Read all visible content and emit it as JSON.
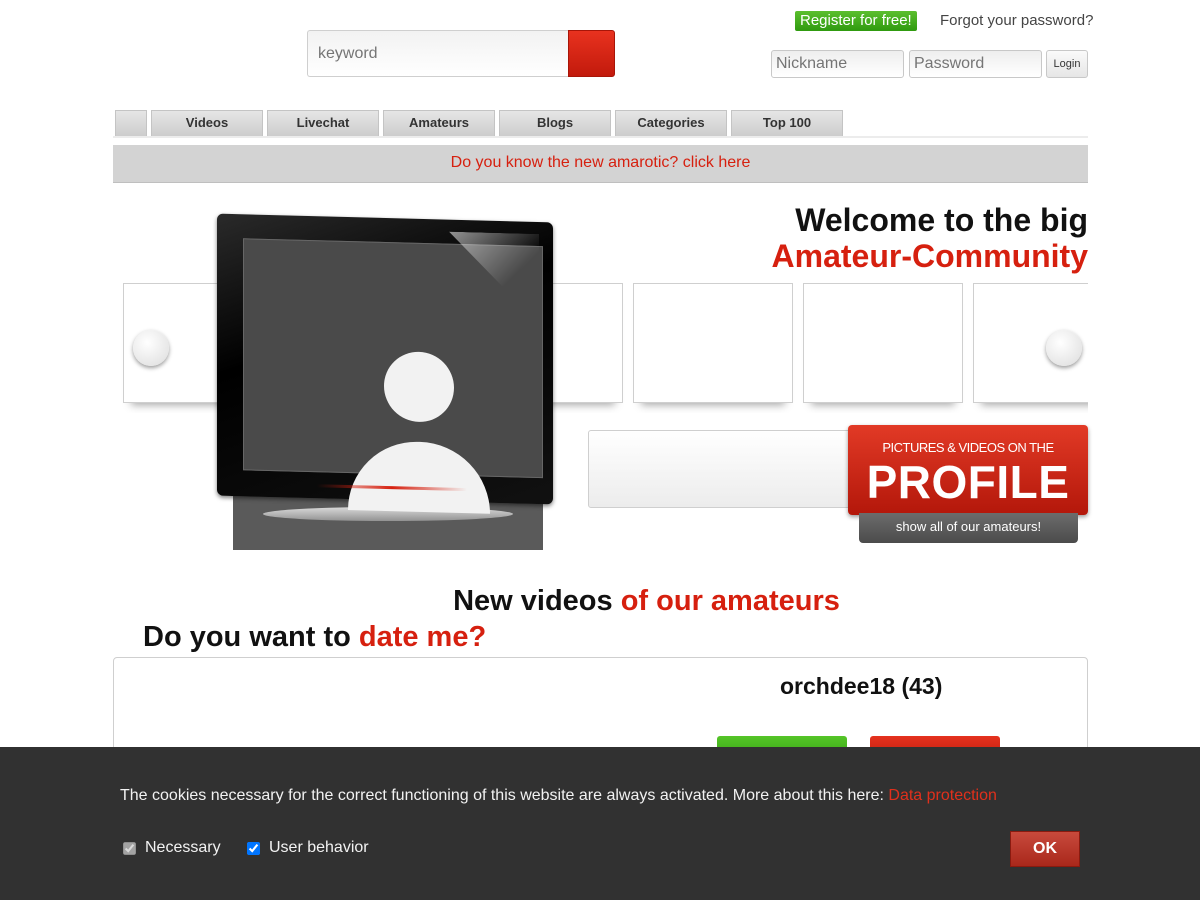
{
  "header": {
    "search_placeholder": "keyword",
    "register_label": "Register for free!",
    "forgot_label": "Forgot your password?",
    "nickname_placeholder": "Nickname",
    "password_placeholder": "Password",
    "login_label": "Login"
  },
  "nav": {
    "tabs": [
      {
        "label": ""
      },
      {
        "label": "Videos"
      },
      {
        "label": "Livechat"
      },
      {
        "label": "Amateurs"
      },
      {
        "label": "Blogs"
      },
      {
        "label": "Categories"
      },
      {
        "label": "Top 100"
      }
    ]
  },
  "notice": "Do you know the new amarotic? click here",
  "welcome": {
    "line1": "Welcome to the big",
    "line2": "Amateur-Community"
  },
  "profile_promo": {
    "small": "PICTURES & VIDEOS ON THE",
    "big": "PROFILE",
    "show_all": "show all of our amateurs!"
  },
  "videos_heading": {
    "part1": "New videos ",
    "part2": "of our amateurs"
  },
  "date_heading": {
    "part1": "Do you want to ",
    "part2": "date me?"
  },
  "date_card": {
    "name": "orchdee18 (43)"
  },
  "cookie": {
    "text": "The cookies necessary for the correct functioning of this website are always activated. More about this here: ",
    "link": "Data protection",
    "necessary_label": "Necessary",
    "behavior_label": "User behavior",
    "ok_label": "OK"
  },
  "colors": {
    "accent_red": "#d6200f",
    "register_green": "#2f9a0f",
    "cookie_bg": "#313131"
  }
}
